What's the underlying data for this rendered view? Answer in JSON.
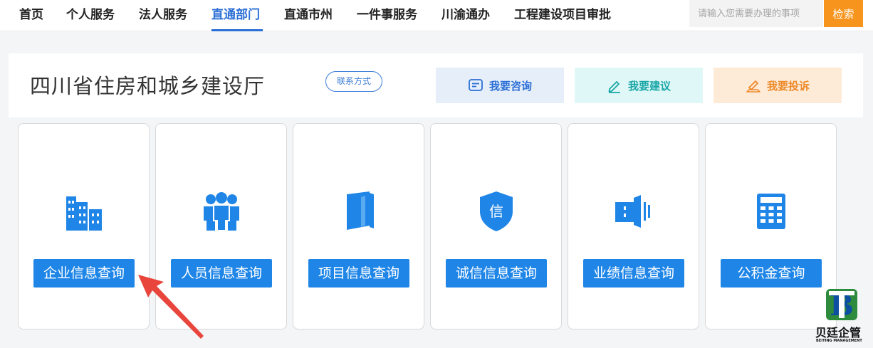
{
  "nav": {
    "items": [
      {
        "label": "首页"
      },
      {
        "label": "个人服务"
      },
      {
        "label": "法人服务"
      },
      {
        "label": "直通部门"
      },
      {
        "label": "直通市州"
      },
      {
        "label": "一件事服务"
      },
      {
        "label": "川渝通办"
      },
      {
        "label": "工程建设项目审批"
      }
    ],
    "active": "直通部门",
    "search_placeholder": "请输入您需要办理的事项",
    "search_button": "检索"
  },
  "department": {
    "title": "四川省住房和城乡建设厅",
    "contact_label": "联系方式",
    "actions": [
      {
        "label": "我要咨询",
        "icon": "message-icon"
      },
      {
        "label": "我要建议",
        "icon": "pencil-icon"
      },
      {
        "label": "我要投诉",
        "icon": "edit-icon"
      }
    ]
  },
  "services": [
    {
      "label": "企业信息查询",
      "icon": "buildings-icon"
    },
    {
      "label": "人员信息查询",
      "icon": "people-icon"
    },
    {
      "label": "项目信息查询",
      "icon": "folder-icon"
    },
    {
      "label": "诚信信息查询",
      "icon": "shield-icon",
      "icon_text": "信"
    },
    {
      "label": "业绩信息查询",
      "icon": "performance-icon"
    },
    {
      "label": "公积金查询",
      "icon": "calculator-icon"
    }
  ],
  "watermark": {
    "name": "贝廷企管",
    "english": "BEITING MANAGEMENT"
  },
  "colors": {
    "primary": "#1f86e8",
    "nav_active": "#2b6fd6",
    "search_button": "#f7941d",
    "arrow": "#e8453c"
  }
}
